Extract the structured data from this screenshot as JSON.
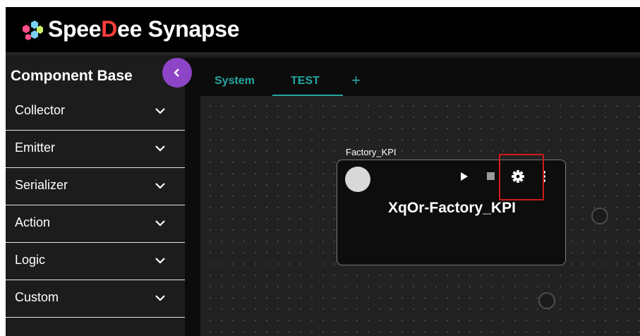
{
  "header": {
    "brand_prefix": "Spee",
    "brand_mark": "D",
    "brand_suffix": "ee Synapse",
    "logo_icon": "hexagon-cluster-logo-icon"
  },
  "sidebar": {
    "title": "Component Base",
    "collapse_icon": "chevron-left-icon",
    "items": [
      {
        "label": "Collector"
      },
      {
        "label": "Emitter"
      },
      {
        "label": "Serializer"
      },
      {
        "label": "Action"
      },
      {
        "label": "Logic"
      },
      {
        "label": "Custom"
      }
    ]
  },
  "tabs": {
    "items": [
      {
        "label": "System"
      },
      {
        "label": "TEST"
      }
    ],
    "active": "TEST",
    "add_label": "+"
  },
  "node": {
    "caption": "Factory_KPI",
    "title": "XqOr-Factory_KPI",
    "icons": [
      "play-icon",
      "stop-icon",
      "gear-icon",
      "more-vertical-icon"
    ]
  },
  "colors": {
    "accent_teal": "#23a6a0",
    "collapse_purple": "#8e44c7",
    "highlight_red": "#d11a1a",
    "brand_d_red": "#ff3d3d"
  }
}
